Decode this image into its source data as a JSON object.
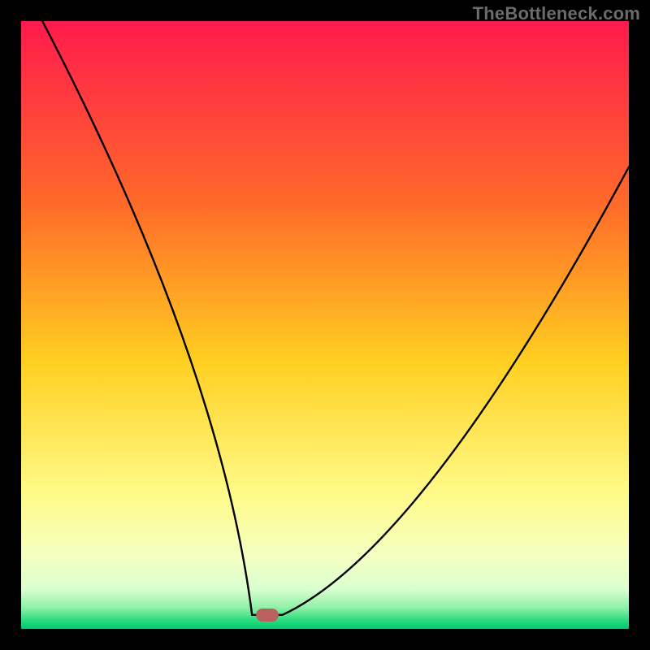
{
  "watermark": "TheBottleneck.com",
  "chart_data": {
    "type": "line",
    "title": "",
    "xlabel": "",
    "ylabel": "",
    "xlim": [
      0,
      100
    ],
    "ylim": [
      0,
      100
    ],
    "gradient_stops": [
      {
        "offset": 0,
        "color": "#ff1a4d"
      },
      {
        "offset": 0.3,
        "color": "#ff6a2a"
      },
      {
        "offset": 0.56,
        "color": "#ffcf20"
      },
      {
        "offset": 0.78,
        "color": "#fffb8a"
      },
      {
        "offset": 0.88,
        "color": "#f5ffc2"
      },
      {
        "offset": 0.935,
        "color": "#d9ffd0"
      },
      {
        "offset": 0.965,
        "color": "#8ff0a8"
      },
      {
        "offset": 0.985,
        "color": "#2fdc80"
      },
      {
        "offset": 1.0,
        "color": "#00c970"
      }
    ],
    "curve": {
      "left_branch_start": {
        "x": 3.5,
        "y": 100
      },
      "minimum_start": {
        "x": 38,
        "y": 2.3
      },
      "minimum_end": {
        "x": 43,
        "y": 2.3
      },
      "right_branch_end": {
        "x": 100,
        "y": 76
      }
    },
    "marker": {
      "x": 40.5,
      "y": 2.3,
      "color": "#b96060"
    }
  }
}
